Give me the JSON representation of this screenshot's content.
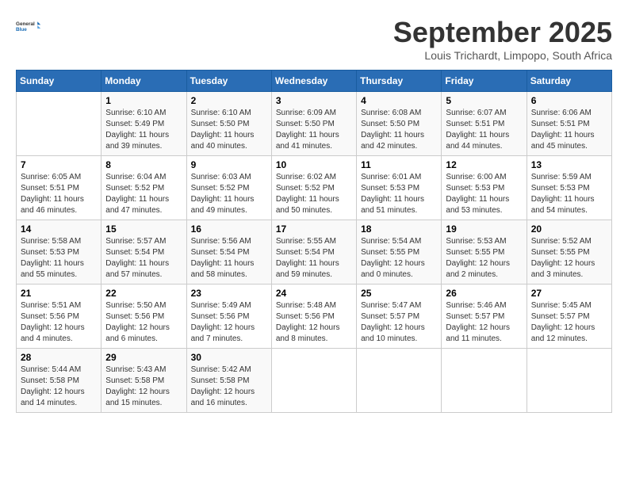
{
  "header": {
    "logo_text_general": "General",
    "logo_text_blue": "Blue",
    "month_title": "September 2025",
    "location": "Louis Trichardt, Limpopo, South Africa"
  },
  "weekdays": [
    "Sunday",
    "Monday",
    "Tuesday",
    "Wednesday",
    "Thursday",
    "Friday",
    "Saturday"
  ],
  "weeks": [
    [
      {
        "day": "",
        "info": ""
      },
      {
        "day": "1",
        "info": "Sunrise: 6:10 AM\nSunset: 5:49 PM\nDaylight: 11 hours\nand 39 minutes."
      },
      {
        "day": "2",
        "info": "Sunrise: 6:10 AM\nSunset: 5:50 PM\nDaylight: 11 hours\nand 40 minutes."
      },
      {
        "day": "3",
        "info": "Sunrise: 6:09 AM\nSunset: 5:50 PM\nDaylight: 11 hours\nand 41 minutes."
      },
      {
        "day": "4",
        "info": "Sunrise: 6:08 AM\nSunset: 5:50 PM\nDaylight: 11 hours\nand 42 minutes."
      },
      {
        "day": "5",
        "info": "Sunrise: 6:07 AM\nSunset: 5:51 PM\nDaylight: 11 hours\nand 44 minutes."
      },
      {
        "day": "6",
        "info": "Sunrise: 6:06 AM\nSunset: 5:51 PM\nDaylight: 11 hours\nand 45 minutes."
      }
    ],
    [
      {
        "day": "7",
        "info": "Sunrise: 6:05 AM\nSunset: 5:51 PM\nDaylight: 11 hours\nand 46 minutes."
      },
      {
        "day": "8",
        "info": "Sunrise: 6:04 AM\nSunset: 5:52 PM\nDaylight: 11 hours\nand 47 minutes."
      },
      {
        "day": "9",
        "info": "Sunrise: 6:03 AM\nSunset: 5:52 PM\nDaylight: 11 hours\nand 49 minutes."
      },
      {
        "day": "10",
        "info": "Sunrise: 6:02 AM\nSunset: 5:52 PM\nDaylight: 11 hours\nand 50 minutes."
      },
      {
        "day": "11",
        "info": "Sunrise: 6:01 AM\nSunset: 5:53 PM\nDaylight: 11 hours\nand 51 minutes."
      },
      {
        "day": "12",
        "info": "Sunrise: 6:00 AM\nSunset: 5:53 PM\nDaylight: 11 hours\nand 53 minutes."
      },
      {
        "day": "13",
        "info": "Sunrise: 5:59 AM\nSunset: 5:53 PM\nDaylight: 11 hours\nand 54 minutes."
      }
    ],
    [
      {
        "day": "14",
        "info": "Sunrise: 5:58 AM\nSunset: 5:53 PM\nDaylight: 11 hours\nand 55 minutes."
      },
      {
        "day": "15",
        "info": "Sunrise: 5:57 AM\nSunset: 5:54 PM\nDaylight: 11 hours\nand 57 minutes."
      },
      {
        "day": "16",
        "info": "Sunrise: 5:56 AM\nSunset: 5:54 PM\nDaylight: 11 hours\nand 58 minutes."
      },
      {
        "day": "17",
        "info": "Sunrise: 5:55 AM\nSunset: 5:54 PM\nDaylight: 11 hours\nand 59 minutes."
      },
      {
        "day": "18",
        "info": "Sunrise: 5:54 AM\nSunset: 5:55 PM\nDaylight: 12 hours\nand 0 minutes."
      },
      {
        "day": "19",
        "info": "Sunrise: 5:53 AM\nSunset: 5:55 PM\nDaylight: 12 hours\nand 2 minutes."
      },
      {
        "day": "20",
        "info": "Sunrise: 5:52 AM\nSunset: 5:55 PM\nDaylight: 12 hours\nand 3 minutes."
      }
    ],
    [
      {
        "day": "21",
        "info": "Sunrise: 5:51 AM\nSunset: 5:56 PM\nDaylight: 12 hours\nand 4 minutes."
      },
      {
        "day": "22",
        "info": "Sunrise: 5:50 AM\nSunset: 5:56 PM\nDaylight: 12 hours\nand 6 minutes."
      },
      {
        "day": "23",
        "info": "Sunrise: 5:49 AM\nSunset: 5:56 PM\nDaylight: 12 hours\nand 7 minutes."
      },
      {
        "day": "24",
        "info": "Sunrise: 5:48 AM\nSunset: 5:56 PM\nDaylight: 12 hours\nand 8 minutes."
      },
      {
        "day": "25",
        "info": "Sunrise: 5:47 AM\nSunset: 5:57 PM\nDaylight: 12 hours\nand 10 minutes."
      },
      {
        "day": "26",
        "info": "Sunrise: 5:46 AM\nSunset: 5:57 PM\nDaylight: 12 hours\nand 11 minutes."
      },
      {
        "day": "27",
        "info": "Sunrise: 5:45 AM\nSunset: 5:57 PM\nDaylight: 12 hours\nand 12 minutes."
      }
    ],
    [
      {
        "day": "28",
        "info": "Sunrise: 5:44 AM\nSunset: 5:58 PM\nDaylight: 12 hours\nand 14 minutes."
      },
      {
        "day": "29",
        "info": "Sunrise: 5:43 AM\nSunset: 5:58 PM\nDaylight: 12 hours\nand 15 minutes."
      },
      {
        "day": "30",
        "info": "Sunrise: 5:42 AM\nSunset: 5:58 PM\nDaylight: 12 hours\nand 16 minutes."
      },
      {
        "day": "",
        "info": ""
      },
      {
        "day": "",
        "info": ""
      },
      {
        "day": "",
        "info": ""
      },
      {
        "day": "",
        "info": ""
      }
    ]
  ]
}
